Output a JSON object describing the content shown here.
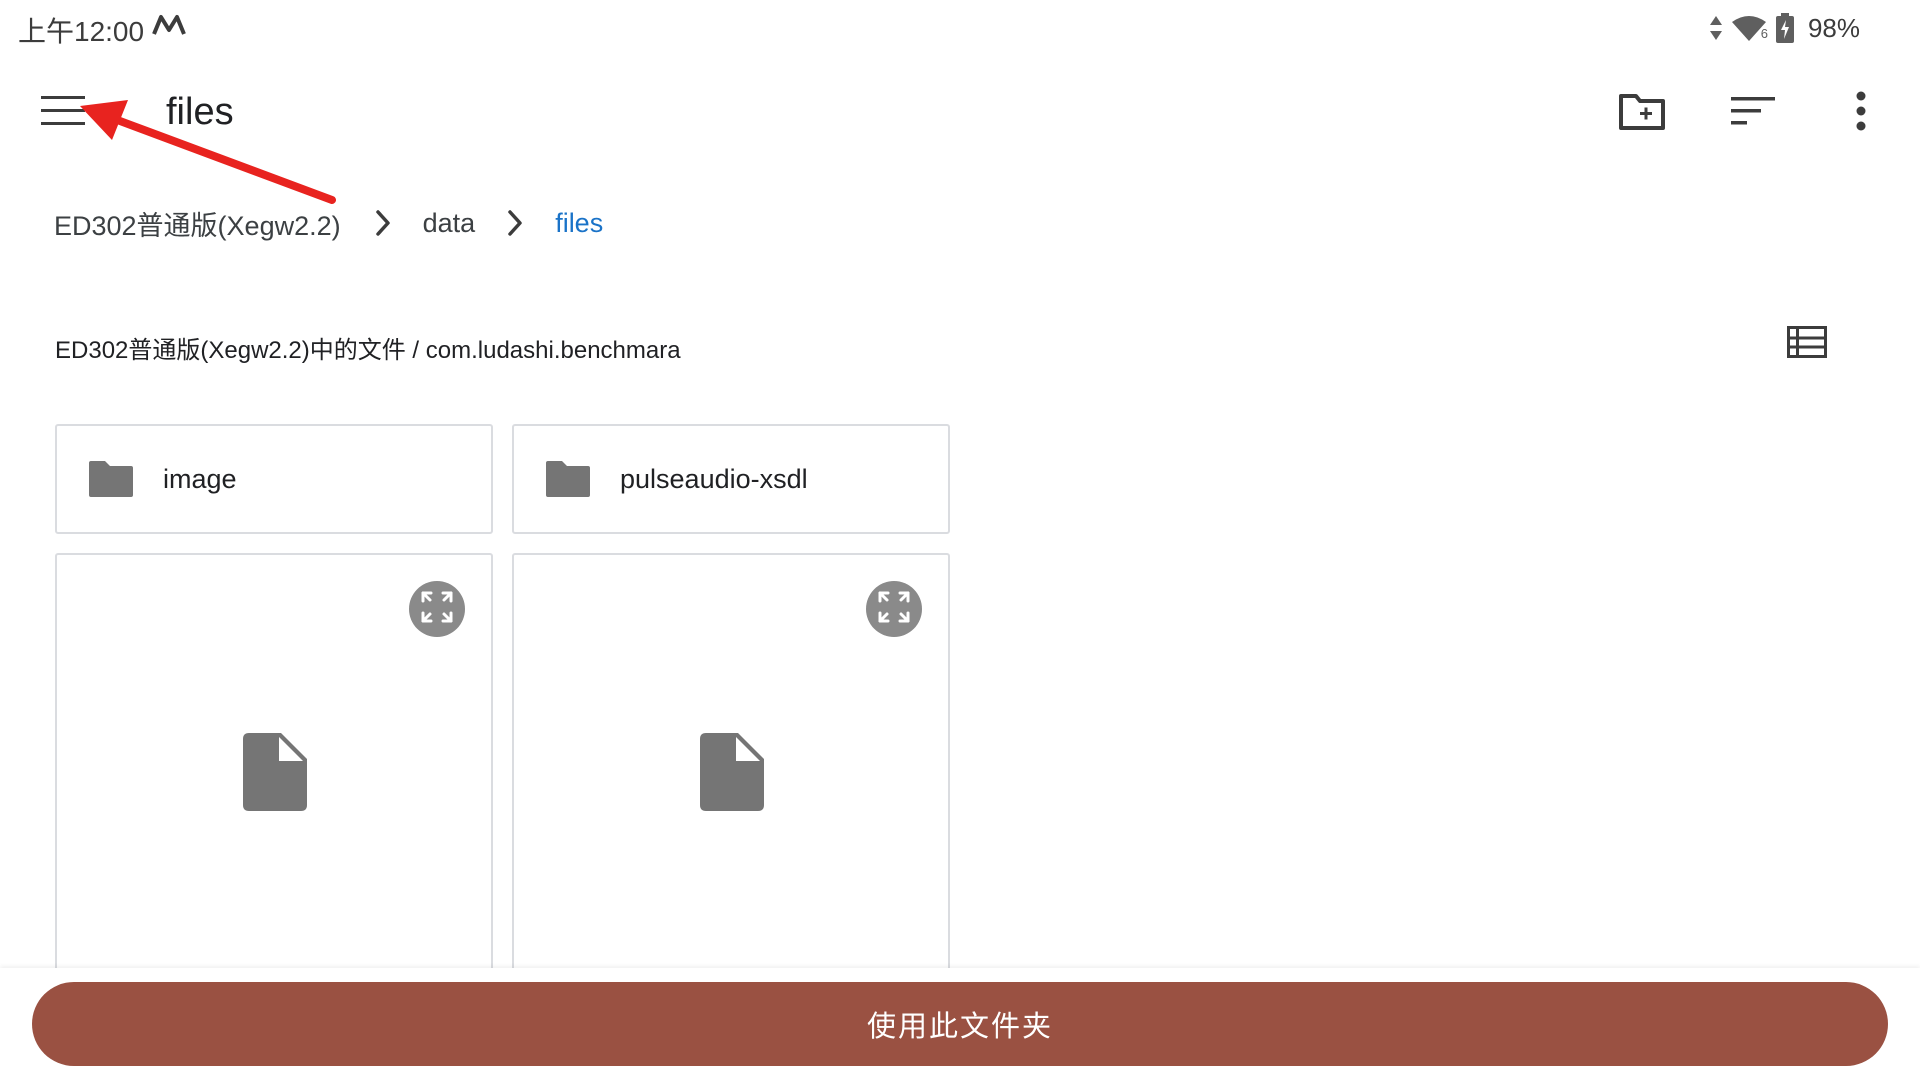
{
  "status_bar": {
    "time": "上午12:00",
    "battery": "98%",
    "network_badge": "6",
    "icons": [
      "app-notification-icon",
      "data-transfer-icon",
      "wifi-icon",
      "battery-charging-icon"
    ]
  },
  "app_bar": {
    "title": "files",
    "icons": [
      "menu-icon",
      "new-folder-icon",
      "sort-icon",
      "more-vert-icon"
    ]
  },
  "breadcrumb": {
    "items": [
      "ED302普通版(Xegw2.2)",
      "data",
      "files"
    ],
    "current_color": "#1a73c8"
  },
  "subheader": {
    "text": "ED302普通版(Xegw2.2)中的文件 / com.ludashi.benchmara"
  },
  "folders": [
    {
      "name": "image"
    },
    {
      "name": "pulseaudio-xsdl"
    }
  ],
  "files": [
    {
      "icon": "file-icon"
    },
    {
      "icon": "file-icon"
    }
  ],
  "bottom": {
    "button_label": "使用此文件夹",
    "button_color": "#9a5142"
  },
  "annotation": {
    "type": "red-arrow",
    "points_to": "menu-button",
    "color": "#e8231f"
  }
}
